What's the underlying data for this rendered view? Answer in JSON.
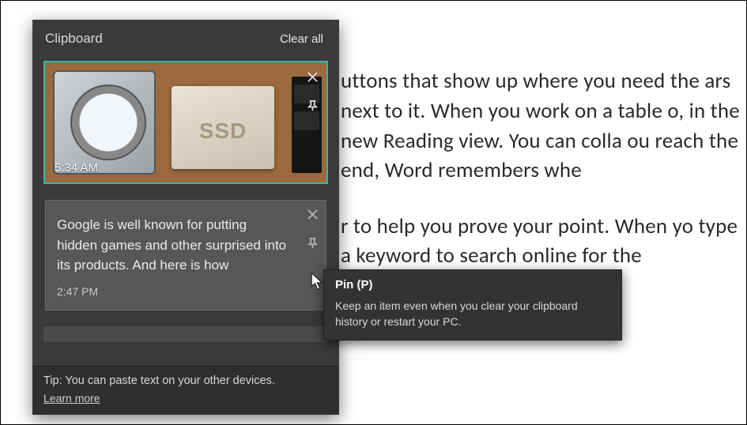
{
  "document": {
    "para1": "uttons that show up where you need the ars next to it. When you work on a table o, in the new Reading view. You can colla ou reach the end, Word remembers whe",
    "para2": "r to help you prove your point. When yo type a keyword to search online for the                                                            over page, a                                                                     ert and then"
  },
  "panel": {
    "title": "Clipboard",
    "clear_all": "Clear all",
    "items": [
      {
        "kind": "image",
        "timestamp": "5:34 AM",
        "ssd_label": "SSD"
      },
      {
        "kind": "text",
        "timestamp": "2:47 PM",
        "text": "Google is well known for putting hidden games and other surprised into its products. And here is how"
      }
    ],
    "tip": {
      "text": "Tip: You can paste text on your other devices.",
      "learn_more": "Learn more"
    }
  },
  "tooltip": {
    "title": "Pin (P)",
    "body": "Keep an item even when you clear your clipboard history or restart your PC."
  }
}
